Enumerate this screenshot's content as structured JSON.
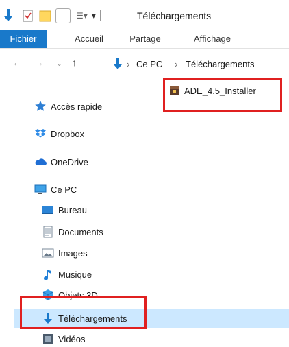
{
  "window": {
    "title": "Téléchargements"
  },
  "colors": {
    "accent": "#1979ca",
    "highlight": "#e02020",
    "selection": "#cce8ff"
  },
  "ribbon": {
    "tabs": [
      {
        "label": "Fichier"
      },
      {
        "label": "Accueil"
      },
      {
        "label": "Partage"
      },
      {
        "label": "Affichage"
      }
    ]
  },
  "address": {
    "crumbs": [
      "Ce PC",
      "Téléchargements"
    ]
  },
  "sidebar": {
    "items": [
      {
        "label": "Accès rapide",
        "icon": "star-pin-icon"
      },
      {
        "label": "Dropbox",
        "icon": "dropbox-icon"
      },
      {
        "label": "OneDrive",
        "icon": "onedrive-cloud-icon"
      },
      {
        "label": "Ce PC",
        "icon": "monitor-icon"
      },
      {
        "label": "Bureau",
        "icon": "desktop-folder-icon"
      },
      {
        "label": "Documents",
        "icon": "documents-icon"
      },
      {
        "label": "Images",
        "icon": "images-icon"
      },
      {
        "label": "Musique",
        "icon": "music-note-icon"
      },
      {
        "label": "Objets 3D",
        "icon": "objects-3d-icon"
      },
      {
        "label": "Téléchargements",
        "icon": "download-arrow-icon"
      },
      {
        "label": "Vidéos",
        "icon": "video-film-icon"
      }
    ]
  },
  "files": [
    {
      "name": "ADE_4.5_Installer",
      "icon": "installer-icon"
    }
  ]
}
